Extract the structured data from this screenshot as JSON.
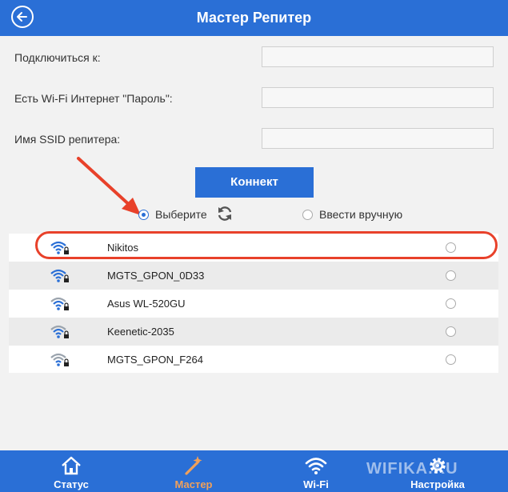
{
  "header": {
    "title": "Мастер Репитер"
  },
  "form": {
    "connect_to_label": "Подключиться к:",
    "password_label": "Есть Wi-Fi Интернет \"Пароль\":",
    "ssid_label": "Имя SSID репитера:",
    "connect_to_value": "",
    "password_value": "",
    "ssid_value": ""
  },
  "connect_button": "Коннект",
  "mode": {
    "select_label": "Выберите",
    "manual_label": "Ввести вручную",
    "selected": "select"
  },
  "networks": [
    {
      "ssid": "Nikitos",
      "selected": false
    },
    {
      "ssid": "MGTS_GPON_0D33",
      "selected": false
    },
    {
      "ssid": "Asus WL-520GU",
      "selected": false
    },
    {
      "ssid": "Keenetic-2035",
      "selected": false
    },
    {
      "ssid": "MGTS_GPON_F264",
      "selected": false
    }
  ],
  "nav": [
    {
      "label": "Статус",
      "icon": "house-icon"
    },
    {
      "label": "Мастер",
      "icon": "wand-icon",
      "active": true
    },
    {
      "label": "Wi-Fi",
      "icon": "wifi-icon"
    },
    {
      "label": "Настройка",
      "icon": "gear-icon"
    }
  ],
  "watermark": "WIFIKA.RU",
  "colors": {
    "primary": "#2a6fd6",
    "accent": "#f0a05a",
    "highlight": "#e8412a"
  }
}
